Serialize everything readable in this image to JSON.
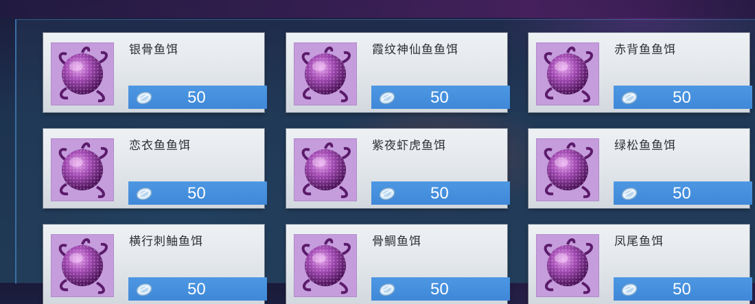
{
  "colors": {
    "card_bg": "#e8ebef",
    "price_bar": "#4690de",
    "thumb_bg": "#c59ddc",
    "bait_purple": "#7a2a8c"
  },
  "icons": {
    "item": "fish-bait-icon",
    "currency": "crystal-coin-icon"
  },
  "shop_items": [
    {
      "name": "银骨鱼饵",
      "price": "50"
    },
    {
      "name": "霞纹神仙鱼鱼饵",
      "price": "50"
    },
    {
      "name": "赤背鱼鱼饵",
      "price": "50"
    },
    {
      "name": "恋衣鱼鱼饵",
      "price": "50"
    },
    {
      "name": "紫夜虾虎鱼饵",
      "price": "50"
    },
    {
      "name": "绿松鱼鱼饵",
      "price": "50"
    },
    {
      "name": "横行刺鲉鱼饵",
      "price": "50"
    },
    {
      "name": "骨鲷鱼饵",
      "price": "50"
    },
    {
      "name": "凤尾鱼饵",
      "price": "50"
    }
  ]
}
